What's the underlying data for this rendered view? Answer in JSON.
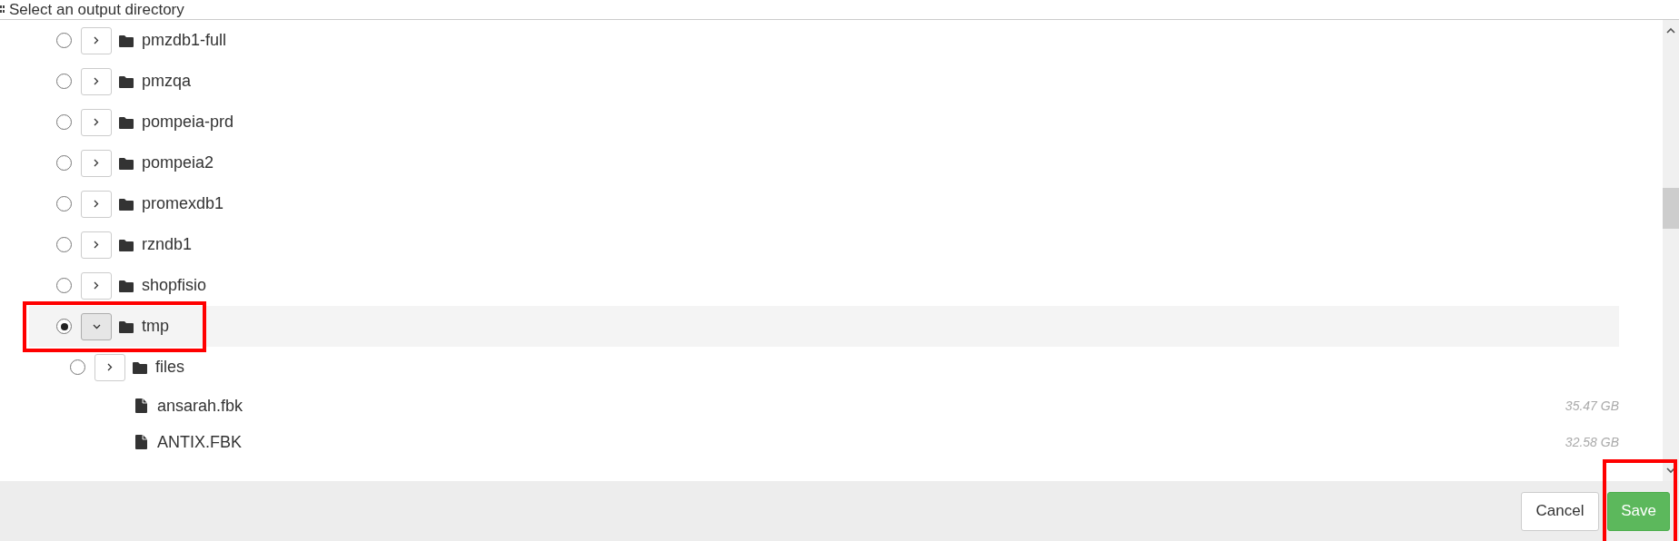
{
  "dialog": {
    "title": "Select an output directory"
  },
  "tree": [
    {
      "kind": "folder",
      "name": "pmzdb1-full",
      "selected": false,
      "expanded": false
    },
    {
      "kind": "folder",
      "name": "pmzqa",
      "selected": false,
      "expanded": false
    },
    {
      "kind": "folder",
      "name": "pompeia-prd",
      "selected": false,
      "expanded": false
    },
    {
      "kind": "folder",
      "name": "pompeia2",
      "selected": false,
      "expanded": false
    },
    {
      "kind": "folder",
      "name": "promexdb1",
      "selected": false,
      "expanded": false
    },
    {
      "kind": "folder",
      "name": "rzndb1",
      "selected": false,
      "expanded": false
    },
    {
      "kind": "folder",
      "name": "shopfisio",
      "selected": false,
      "expanded": false
    },
    {
      "kind": "folder",
      "name": "tmp",
      "selected": true,
      "expanded": true,
      "children": [
        {
          "kind": "folder",
          "name": "files",
          "selected": false,
          "expanded": false
        },
        {
          "kind": "file",
          "name": "ansarah.fbk",
          "size": "35.47 GB"
        },
        {
          "kind": "file",
          "name": "ANTIX.FBK",
          "size": "32.58 GB"
        }
      ]
    }
  ],
  "buttons": [
    {
      "kind": "default",
      "label": "Cancel"
    },
    {
      "kind": "primary",
      "label": "Save"
    }
  ]
}
